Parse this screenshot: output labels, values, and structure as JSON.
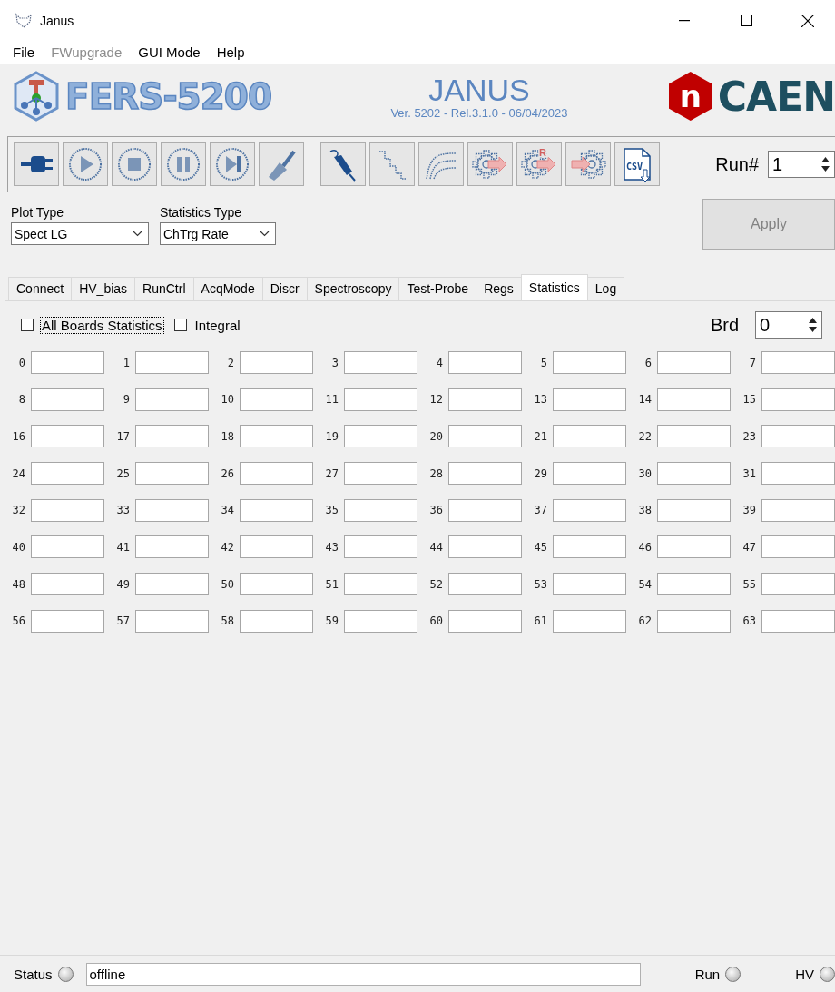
{
  "window": {
    "title": "Janus"
  },
  "menu": [
    {
      "label": "File",
      "disabled": false
    },
    {
      "label": "FWupgrade",
      "disabled": true
    },
    {
      "label": "GUI Mode",
      "disabled": false
    },
    {
      "label": "Help",
      "disabled": false
    }
  ],
  "header": {
    "product": "FERS-5200",
    "title": "JANUS",
    "version": "Ver. 5202 - Rel.3.1.0 - 06/04/2023",
    "brand": "CAEN",
    "brand_mark": "n"
  },
  "toolbar": [
    [
      {
        "kind": "plug",
        "disabled": false
      },
      {
        "kind": "play",
        "disabled": true
      },
      {
        "kind": "stop",
        "disabled": true
      },
      {
        "kind": "pause",
        "disabled": true
      },
      {
        "kind": "next",
        "disabled": true
      },
      {
        "kind": "brush",
        "disabled": true
      }
    ],
    [
      {
        "kind": "probe",
        "disabled": false
      },
      {
        "kind": "stairs",
        "disabled": true
      },
      {
        "kind": "curves",
        "disabled": true
      },
      {
        "kind": "gear-out",
        "disabled": true
      },
      {
        "kind": "gear-out",
        "disabled": true,
        "badge": "R"
      },
      {
        "kind": "gear-in",
        "disabled": true
      },
      {
        "kind": "file",
        "disabled": false,
        "badge": "CSV"
      }
    ]
  ],
  "run": {
    "label": "Run#",
    "value": "1"
  },
  "plot_type": {
    "label": "Plot Type",
    "value": "Spect LG"
  },
  "statistics_type": {
    "label": "Statistics Type",
    "value": "ChTrg Rate"
  },
  "apply": {
    "label": "Apply",
    "disabled": true
  },
  "tabs": [
    {
      "label": "Connect",
      "selected": false
    },
    {
      "label": "HV_bias",
      "selected": false
    },
    {
      "label": "RunCtrl",
      "selected": false
    },
    {
      "label": "AcqMode",
      "selected": false
    },
    {
      "label": "Discr",
      "selected": false
    },
    {
      "label": "Spectroscopy",
      "selected": false
    },
    {
      "label": "Test-Probe",
      "selected": false
    },
    {
      "label": "Regs",
      "selected": false
    },
    {
      "label": "Statistics",
      "selected": true
    },
    {
      "label": "Log",
      "selected": false
    }
  ],
  "options": [
    {
      "label": "All Boards Statistics",
      "checked": false,
      "focused": true
    },
    {
      "label": "Integral",
      "checked": false,
      "focused": false
    }
  ],
  "board": {
    "label": "Brd",
    "value": "0"
  },
  "channels": [
    "0",
    "1",
    "2",
    "3",
    "4",
    "5",
    "6",
    "7",
    "8",
    "9",
    "10",
    "11",
    "12",
    "13",
    "14",
    "15",
    "16",
    "17",
    "18",
    "19",
    "20",
    "21",
    "22",
    "23",
    "24",
    "25",
    "26",
    "27",
    "28",
    "29",
    "30",
    "31",
    "32",
    "33",
    "34",
    "35",
    "36",
    "37",
    "38",
    "39",
    "40",
    "41",
    "42",
    "43",
    "44",
    "45",
    "46",
    "47",
    "48",
    "49",
    "50",
    "51",
    "52",
    "53",
    "54",
    "55",
    "56",
    "57",
    "58",
    "59",
    "60",
    "61",
    "62",
    "63"
  ],
  "status_bar": {
    "label": "Status",
    "led_on": false,
    "message": "offline",
    "indicators": [
      {
        "label": "Run",
        "on": false
      },
      {
        "label": "HV",
        "on": false
      }
    ]
  }
}
